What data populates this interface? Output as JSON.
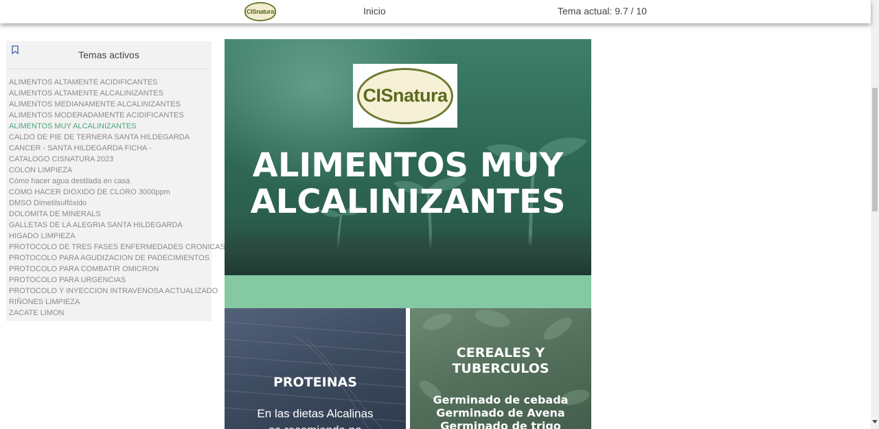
{
  "header": {
    "logo_text": "CISnatura",
    "nav_home": "Inicio",
    "topic_status": "Tema actual: 9.7 / 10"
  },
  "sidebar": {
    "title": "Temas activos",
    "items": [
      {
        "label": "ALIMENTOS ALTAMENTE ACIDIFICANTES"
      },
      {
        "label": "ALIMENTOS ALTAMENTE ALCALINIZANTES"
      },
      {
        "label": "ALIMENTOS MEDIANAMENTE ALCALINIZANTES"
      },
      {
        "label": "ALIMENTOS MODERADAMENTE ACIDIFICANTES"
      },
      {
        "label": "ALIMENTOS MUY ALCALINIZANTES",
        "active": true
      },
      {
        "label": "CALDO DE PIE DE TERNERA SANTA HILDEGARDA"
      },
      {
        "label": "CANCER - SANTA HILDEGARDA FICHA -"
      },
      {
        "label": "CATALOGO CISNATURA 2023"
      },
      {
        "label": "COLON LIMPIEZA"
      },
      {
        "label": "Cómo hacer agua destilada en casa"
      },
      {
        "label": "COMO HACER DIOXIDO DE CLORO 3000ppm"
      },
      {
        "label": "DMSO Dimetilsulfóxido"
      },
      {
        "label": "DOLOMITA DE MINERALS"
      },
      {
        "label": "GALLETAS DE LA ALEGRIA SANTA HILDEGARDA"
      },
      {
        "label": "HIGADO LIMPIEZA"
      },
      {
        "label": "PROTOCOLO DE TRES FASES ENFERMEDADES CRONICAS"
      },
      {
        "label": "PROTOCOLO PARA AGUDIZACION DE PADECIMIENTOS"
      },
      {
        "label": "PROTOCOLO PARA COMBATIR OMICRON"
      },
      {
        "label": "PROTOCOLO PARA URGENCIAS"
      },
      {
        "label": "PROTOCOLO Y INYECCION INTRAVENOSA ACTUALIZADO"
      },
      {
        "label": "RIÑONES LIMPIEZA"
      },
      {
        "label": "ZACATE LIMON"
      }
    ]
  },
  "main": {
    "hero_logo_text": "CISnatura",
    "hero_title_line1": "ALIMENTOS MUY",
    "hero_title_line2": "ALCALINIZANTES",
    "card_left": {
      "title": "PROTEINAS",
      "text_line1": "En las dietas Alcalinas",
      "text_line2": "se recomienda no"
    },
    "card_right": {
      "title_line1": "CEREALES Y",
      "title_line2": "TUBERCULOS",
      "items": [
        "Germinado de cebada",
        "Germinado de Avena",
        "Germinado de trigo"
      ]
    }
  },
  "colors": {
    "accent_active": "#4aa77a",
    "band": "#85c9a3",
    "hero_bg": "#2f6a57"
  }
}
